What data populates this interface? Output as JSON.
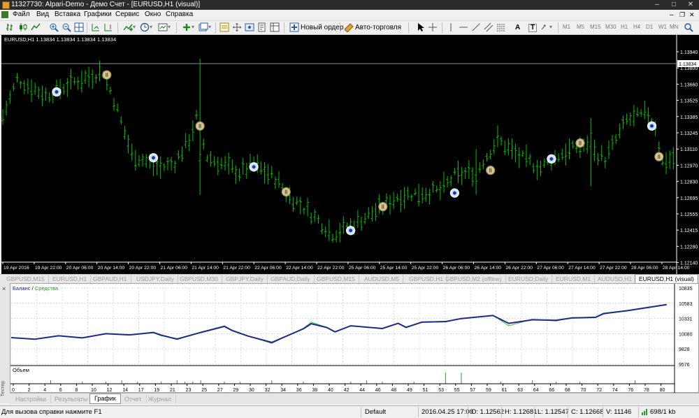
{
  "window": {
    "title": "11327730: Alpari-Demo - Демо Счет - [EURUSD,H1 (visual)]"
  },
  "menu": [
    "Файл",
    "Вид",
    "Вставка",
    "Графики",
    "Сервис",
    "Окно",
    "Справка"
  ],
  "toolbar": {
    "new_order": "Новый ордер",
    "autotrading": "Авто-торговля",
    "text_tool": "A",
    "label_tool": "T",
    "timeframes": [
      "M1",
      "M5",
      "M15",
      "M30",
      "H1",
      "H4",
      "D1",
      "W1",
      "MN"
    ]
  },
  "chart": {
    "info": "EURUSD,H1  1.13834 1.13834 1.13834 1.13834",
    "price_levels": [
      "1.13940",
      "1.13800",
      "1.13660",
      "1.13525",
      "1.13385",
      "1.13245",
      "1.13110",
      "1.12970",
      "1.12830",
      "1.12695",
      "1.12555",
      "1.12415",
      "1.12280",
      "1.12140"
    ],
    "current_price": "1.13834",
    "time_labels": [
      "19 Apr 2016",
      "19 Apr 22:00",
      "20 Apr 06:00",
      "20 Apr 14:00",
      "20 Apr 22:00",
      "21 Apr 06:00",
      "21 Apr 14:00",
      "21 Apr 22:00",
      "22 Apr 06:00",
      "22 Apr 14:00",
      "22 Apr 22:00",
      "25 Apr 06:00",
      "25 Apr 14:00",
      "25 Apr 22:00",
      "26 Apr 06:00",
      "26 Apr 14:00",
      "26 Apr 22:00",
      "27 Apr 06:00",
      "27 Apr 14:00",
      "27 Apr 22:00",
      "28 Apr 06:00",
      "28 Apr 14:00"
    ],
    "colors": {
      "up": "#00c000",
      "down": "#00c000",
      "bg": "#000000",
      "text": "#ffffff"
    },
    "trade_markers": [
      {
        "bar": 15,
        "price": 1.1357,
        "type": "buy"
      },
      {
        "bar": 29,
        "price": 1.1372,
        "type": "sell"
      },
      {
        "bar": 42,
        "price": 1.1299,
        "type": "buy"
      },
      {
        "bar": 55,
        "price": 1.1327,
        "type": "sell"
      },
      {
        "bar": 70,
        "price": 1.1291,
        "type": "buy"
      },
      {
        "bar": 79,
        "price": 1.1269,
        "type": "sell"
      },
      {
        "bar": 97,
        "price": 1.1235,
        "type": "buy"
      },
      {
        "bar": 106,
        "price": 1.1256,
        "type": "sell"
      },
      {
        "bar": 126,
        "price": 1.1268,
        "type": "buy"
      },
      {
        "bar": 136,
        "price": 1.1288,
        "type": "sell"
      },
      {
        "bar": 153,
        "price": 1.1298,
        "type": "buy"
      },
      {
        "bar": 161,
        "price": 1.1312,
        "type": "sell"
      },
      {
        "bar": 181,
        "price": 1.1327,
        "type": "buy"
      },
      {
        "bar": 183,
        "price": 1.13,
        "type": "sell"
      }
    ]
  },
  "chart_tabs": [
    "GBPUSD,M15",
    "EURUSD,H1",
    "GBPAUD,H1",
    "USDJPY,Daily",
    "GBPUSD,M30",
    "GBPJPY,Daily",
    "GBPAUD,Daily",
    "GBPUSD,M15",
    "AUDUSD,M5",
    "GBPUSD,H1",
    "GBPUSD,M2 (offline)",
    "EURUSD,Daily",
    "EURUSD,M1",
    "AUDUSD,H1",
    "EURUSD,H1 (visual)"
  ],
  "tester": {
    "legend_balance": "Баланс",
    "legend_sep": " / ",
    "legend_equity": "Средства",
    "volume_label": "Объем",
    "y_labels": [
      "10835",
      "10583",
      "10331",
      "10080",
      "9828",
      "9576"
    ],
    "x_labels": [
      "0",
      "2",
      "4",
      "6",
      "8",
      "10",
      "12",
      "14",
      "17",
      "19",
      "21",
      "23",
      "25",
      "27",
      "29",
      "30",
      "32",
      "34",
      "36",
      "38",
      "40",
      "42",
      "44",
      "46",
      "48",
      "49",
      "51",
      "53",
      "55",
      "57",
      "59",
      "61",
      "63",
      "64",
      "66",
      "68",
      "70",
      "72",
      "74",
      "76",
      "78",
      "80"
    ],
    "chart_data": {
      "type": "line",
      "x": [
        0,
        3,
        6,
        9,
        12,
        15,
        18,
        19,
        21,
        24,
        27,
        28,
        30,
        33,
        37,
        38,
        40,
        41,
        43,
        47,
        49,
        50,
        52,
        55,
        57,
        61,
        63,
        66,
        69,
        71,
        74,
        75,
        78,
        80,
        83
      ],
      "series": [
        {
          "name": "Баланс",
          "values": [
            10015,
            9990,
            10045,
            10010,
            10080,
            10060,
            10100,
            10055,
            9990,
            10100,
            10200,
            10130,
            10040,
            9935,
            10160,
            10245,
            10180,
            10110,
            10210,
            10165,
            10250,
            10185,
            10270,
            10280,
            10330,
            10380,
            10250,
            10310,
            10300,
            10340,
            10350,
            10410,
            10460,
            10500,
            10560
          ]
        },
        {
          "name": "Средства",
          "values": [
            10015,
            9990,
            10045,
            10010,
            10080,
            10060,
            10095,
            10045,
            10000,
            10105,
            10210,
            10140,
            10045,
            9920,
            10170,
            10270,
            10185,
            10105,
            10215,
            10160,
            10255,
            10175,
            10275,
            10285,
            10330,
            10385,
            10210,
            10320,
            10290,
            10345,
            10355,
            10420,
            10465,
            10505,
            10565
          ]
        }
      ],
      "ylim": [
        9576,
        10835
      ]
    },
    "colors": {
      "balance": "#1c2a8a",
      "equity": "#3cb83c"
    }
  },
  "side_strip_label": "Тестер",
  "bottom_tabs": [
    "Настройки",
    "Результаты",
    "График",
    "Отчет",
    "Журнал"
  ],
  "bottom_active": "График",
  "status": {
    "help": "Для вызова справки нажмите F1",
    "profile": "Default",
    "time": "2016.04.25 17:00",
    "open": "O: 1.12562",
    "high": "H: 1.12681",
    "low": "L: 1.12547",
    "close": "C: 1.12668",
    "volume": "V: 11146",
    "traffic": "698/1 kb"
  }
}
